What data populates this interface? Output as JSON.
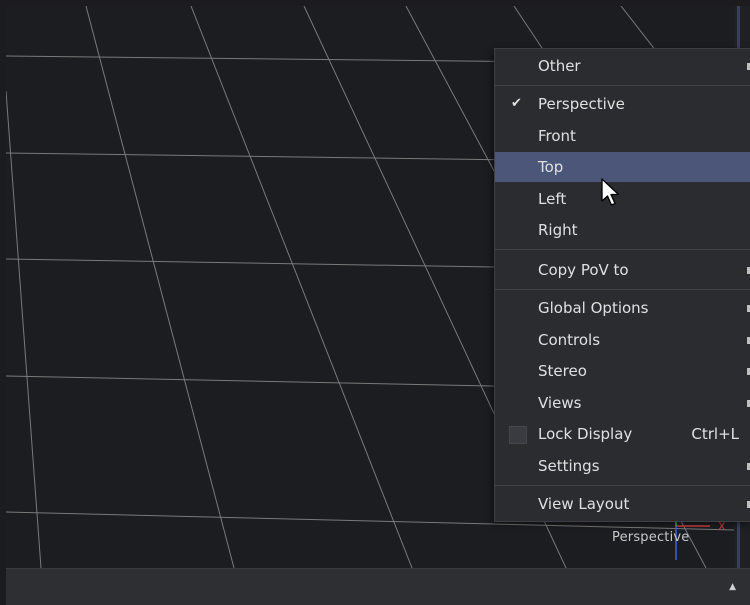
{
  "viewport": {
    "view_label": "Perspective"
  },
  "menu": {
    "other_label": "Other",
    "perspective_label": "Perspective",
    "perspective_checked": true,
    "front_label": "Front",
    "top_label": "Top",
    "left_label": "Left",
    "right_label": "Right",
    "copy_pov_label": "Copy PoV to",
    "global_options_label": "Global Options",
    "controls_label": "Controls",
    "stereo_label": "Stereo",
    "views_label": "Views",
    "lock_display_label": "Lock Display",
    "lock_display_shortcut": "Ctrl+L",
    "lock_display_checked": false,
    "settings_label": "Settings",
    "view_layout_label": "View Layout",
    "highlighted_item": "Top"
  },
  "icons": {
    "check": "checkmark-icon",
    "submenu": "chevron-right-icon",
    "cursor": "mouse-pointer-icon",
    "status_arrow": "triangle-up-icon"
  },
  "colors": {
    "viewport_bg": "#1c1d20",
    "menu_bg": "#2b2c30",
    "highlight": "#4b5678",
    "axis_x": "#d04040",
    "axis_y": "#40c040",
    "axis_z": "#4060e0"
  }
}
